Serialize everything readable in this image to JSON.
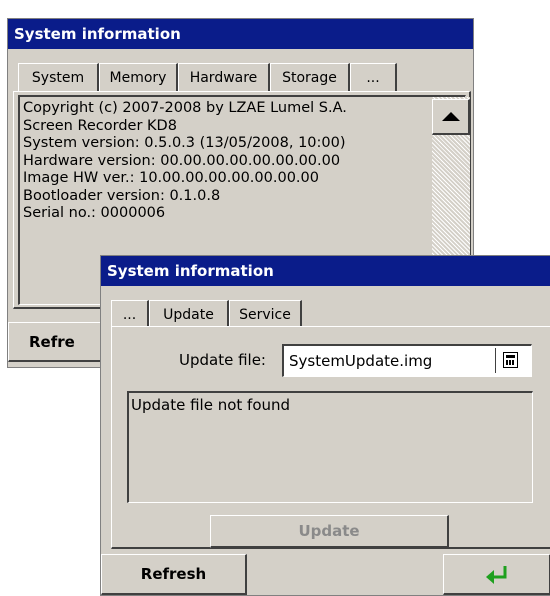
{
  "back_window": {
    "title": "System information",
    "tabs": [
      "System",
      "Memory",
      "Hardware",
      "Storage",
      "..."
    ],
    "info_lines": [
      "Copyright (c) 2007-2008 by LZAE Lumel S.A.",
      "Screen Recorder KD8",
      "System version: 0.5.0.3 (13/05/2008, 10:00)",
      "Hardware version: 00.00.00.00.00.00.00.00",
      "Image HW ver.: 10.00.00.00.00.00.00.00",
      "Bootloader version: 0.1.0.8",
      "Serial no.: 0000006"
    ],
    "refresh_label": "Refre"
  },
  "front_window": {
    "title": "System information",
    "tabs": [
      "...",
      "Update",
      "Service"
    ],
    "update_file_label": "Update file:",
    "update_file_value": "SystemUpdate.img",
    "status_text": "Update file not found",
    "update_button": "Update",
    "refresh_button": "Refresh",
    "enter_icon": "enter-arrow-icon"
  },
  "colors": {
    "titlebar": "#0a1c8a",
    "face": "#d4d0c8",
    "enter_arrow": "#1ea01e"
  }
}
